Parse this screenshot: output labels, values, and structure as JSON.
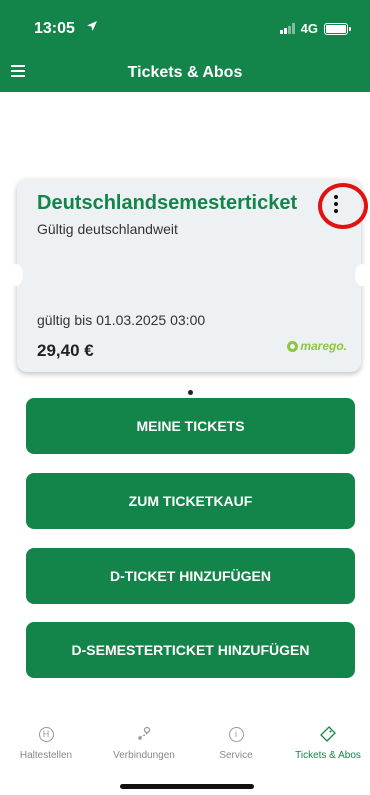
{
  "status": {
    "time": "13:05",
    "network": "4G",
    "location_icon": "location-arrow-icon"
  },
  "appbar": {
    "title": "Tickets & Abos",
    "menu_icon": "hamburger-icon"
  },
  "ticket": {
    "title": "Deutschlandsemesterticket",
    "subtitle": "Gültig deutschlandweit",
    "valid_until": "gültig bis 01.03.2025 03:00",
    "price": "29,40 €",
    "brand": "marego.",
    "brand_color": "#8ec63f"
  },
  "buttons": {
    "my_tickets": "MEINE TICKETS",
    "buy_ticket": "ZUM TICKETKAUF",
    "add_dticket": "D-TICKET HINZUFÜGEN",
    "add_dsemester": "D-SEMESTERTICKET HINZUFÜGEN"
  },
  "tabs": [
    {
      "label": "Haltestellen",
      "icon": "stop-h-icon",
      "glyph": "H"
    },
    {
      "label": "Verbindungen",
      "icon": "route-icon",
      "glyph": "⚲"
    },
    {
      "label": "Service",
      "icon": "info-icon",
      "glyph": "i"
    },
    {
      "label": "Tickets & Abos",
      "icon": "ticket-icon",
      "glyph": "◇",
      "active": true
    }
  ],
  "colors": {
    "primary": "#14854a",
    "highlight": "#e01212"
  }
}
